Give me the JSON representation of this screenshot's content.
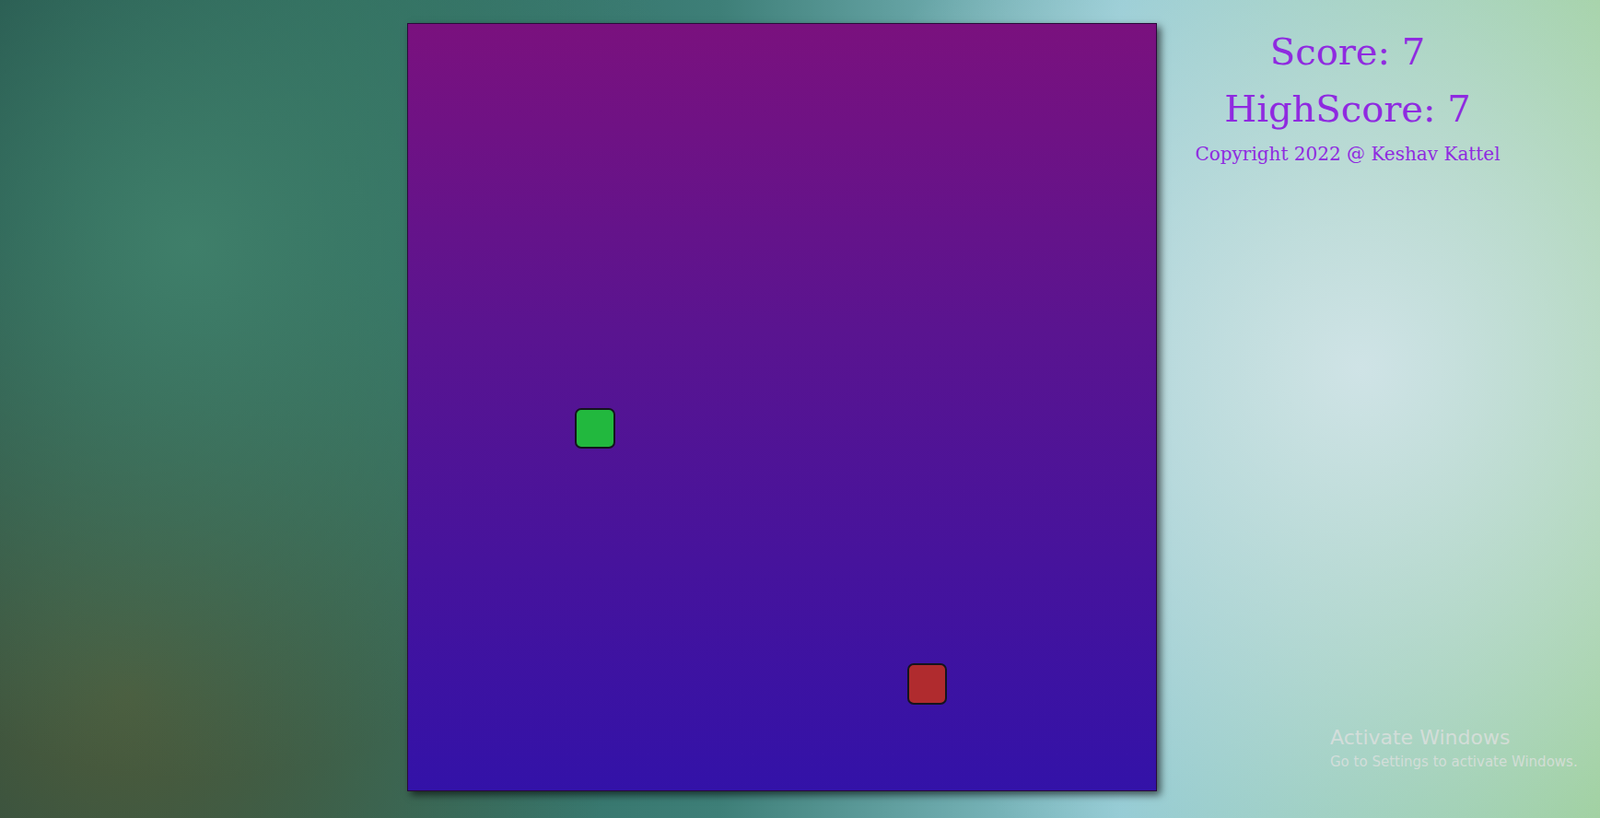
{
  "game": {
    "grid_size": 18,
    "snake": [
      {
        "x": 5,
        "y": 10,
        "color": "#22b83e"
      }
    ],
    "food": {
      "x": 13,
      "y": 16,
      "color": "#b02b2e"
    }
  },
  "scoreboard": {
    "score": "Score: 7",
    "high_score": "HighScore: 7",
    "copyright": "Copyright 2022 @ Keshav Kattel"
  },
  "watermark": {
    "title": "Activate Windows",
    "subtitle": "Go to Settings to activate Windows."
  }
}
